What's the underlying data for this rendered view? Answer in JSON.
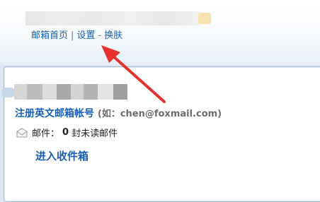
{
  "header": {
    "links": [
      "邮箱首页",
      "设置",
      "换肤"
    ],
    "separators": [
      "|",
      "-"
    ]
  },
  "account": {
    "register_label": "注册英文邮箱帐号",
    "register_hint": "(如：chen@foxmail.com)",
    "mail_label": "邮件：",
    "unread_count": "0",
    "unread_suffix": "封未读邮件",
    "inbox_label": "进入收件箱"
  },
  "icons": {
    "mail": "envelope-icon",
    "annotation": "red-arrow"
  },
  "colors": {
    "link": "#1a5fb4",
    "annotation": "#e5322d",
    "card_border": "#9fb8d6"
  }
}
